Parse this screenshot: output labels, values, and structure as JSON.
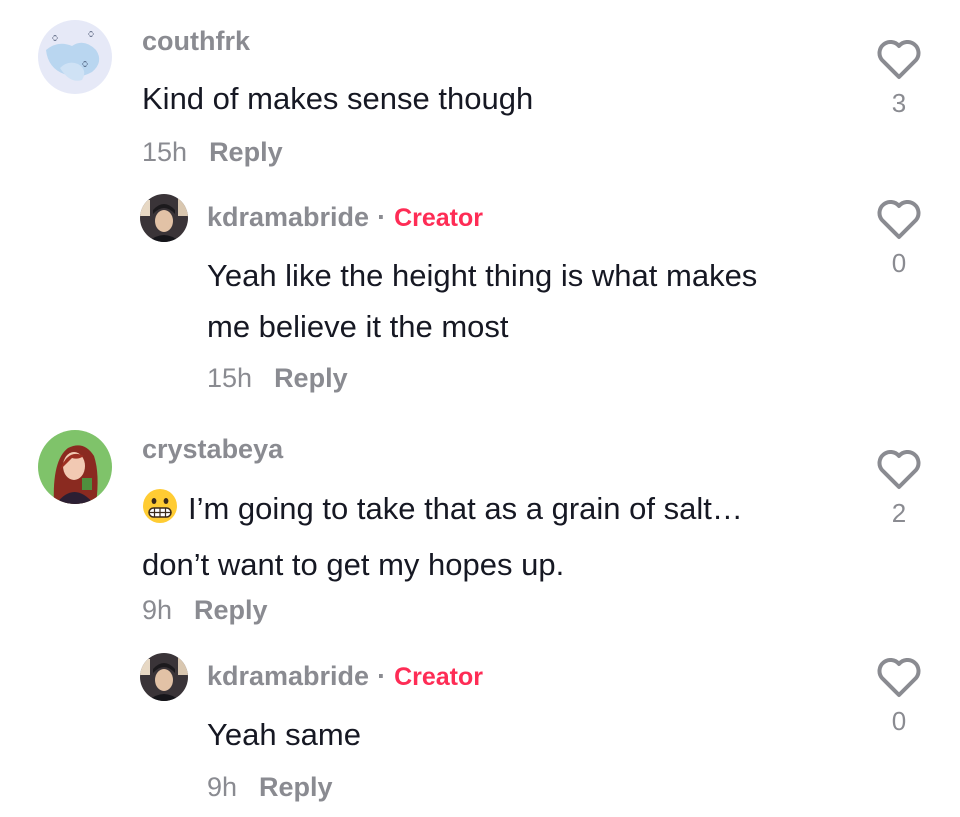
{
  "comments": [
    {
      "username": "couthfrk",
      "text_lines": [
        "Kind of makes sense though"
      ],
      "time": "15h",
      "reply_label": "Reply",
      "likes": "3",
      "avatar": "butterfly-avatar",
      "replies": [
        {
          "username": "kdramabride",
          "separator": "·",
          "badge": "Creator",
          "text_lines": [
            "Yeah like the height thing is what makes",
            "me believe it the most"
          ],
          "time": "15h",
          "reply_label": "Reply",
          "likes": "0",
          "avatar": "person-avatar"
        }
      ]
    },
    {
      "username": "crystabeya",
      "text_lines": [
        "I’m going to take that as a grain of salt…",
        "don’t want to get my hopes up."
      ],
      "emoji": "grimacing-face-emoji",
      "time": "9h",
      "reply_label": "Reply",
      "likes": "2",
      "avatar": "illustrated-woman-avatar",
      "replies": [
        {
          "username": "kdramabride",
          "separator": "·",
          "badge": "Creator",
          "text_lines": [
            "Yeah same"
          ],
          "time": "9h",
          "reply_label": "Reply",
          "likes": "0",
          "avatar": "person-avatar"
        }
      ]
    }
  ],
  "colors": {
    "username": "#8a8b91",
    "creator_badge": "#fe2c55",
    "text": "#161823",
    "heart_outline": "#8a8b91"
  }
}
